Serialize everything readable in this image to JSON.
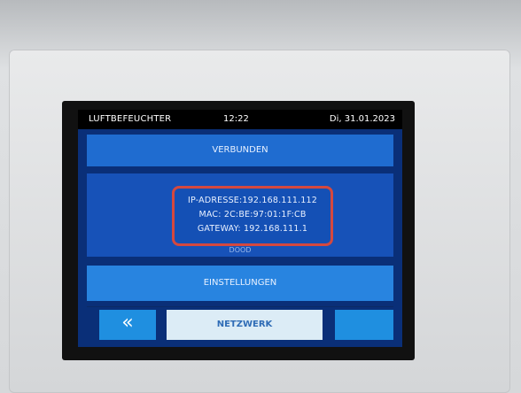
{
  "status_bar": {
    "device_name": "LUFTBEFEUCHTER",
    "time": "12:22",
    "date": "Di, 31.01.2023"
  },
  "connection_status": "VERBUNDEN",
  "network_info": {
    "ip_label": "IP-ADRESSE:",
    "ip_value": "192.168.111.112",
    "mac_label": "MAC:",
    "mac_value": "2C:BE:97:01:1F:CB",
    "gateway_label": "GATEWAY:",
    "gateway_value": "192.168.111.1"
  },
  "partial_label": "DOOD",
  "settings_label": "EINSTELLUNGEN",
  "bottom_nav": {
    "back_glyph": "«",
    "network_label": "NETZWERK"
  },
  "colors": {
    "highlight_box": "#d4483f",
    "panel_blue": "#1f6cd0",
    "screen_bg": "#0a2f78"
  }
}
